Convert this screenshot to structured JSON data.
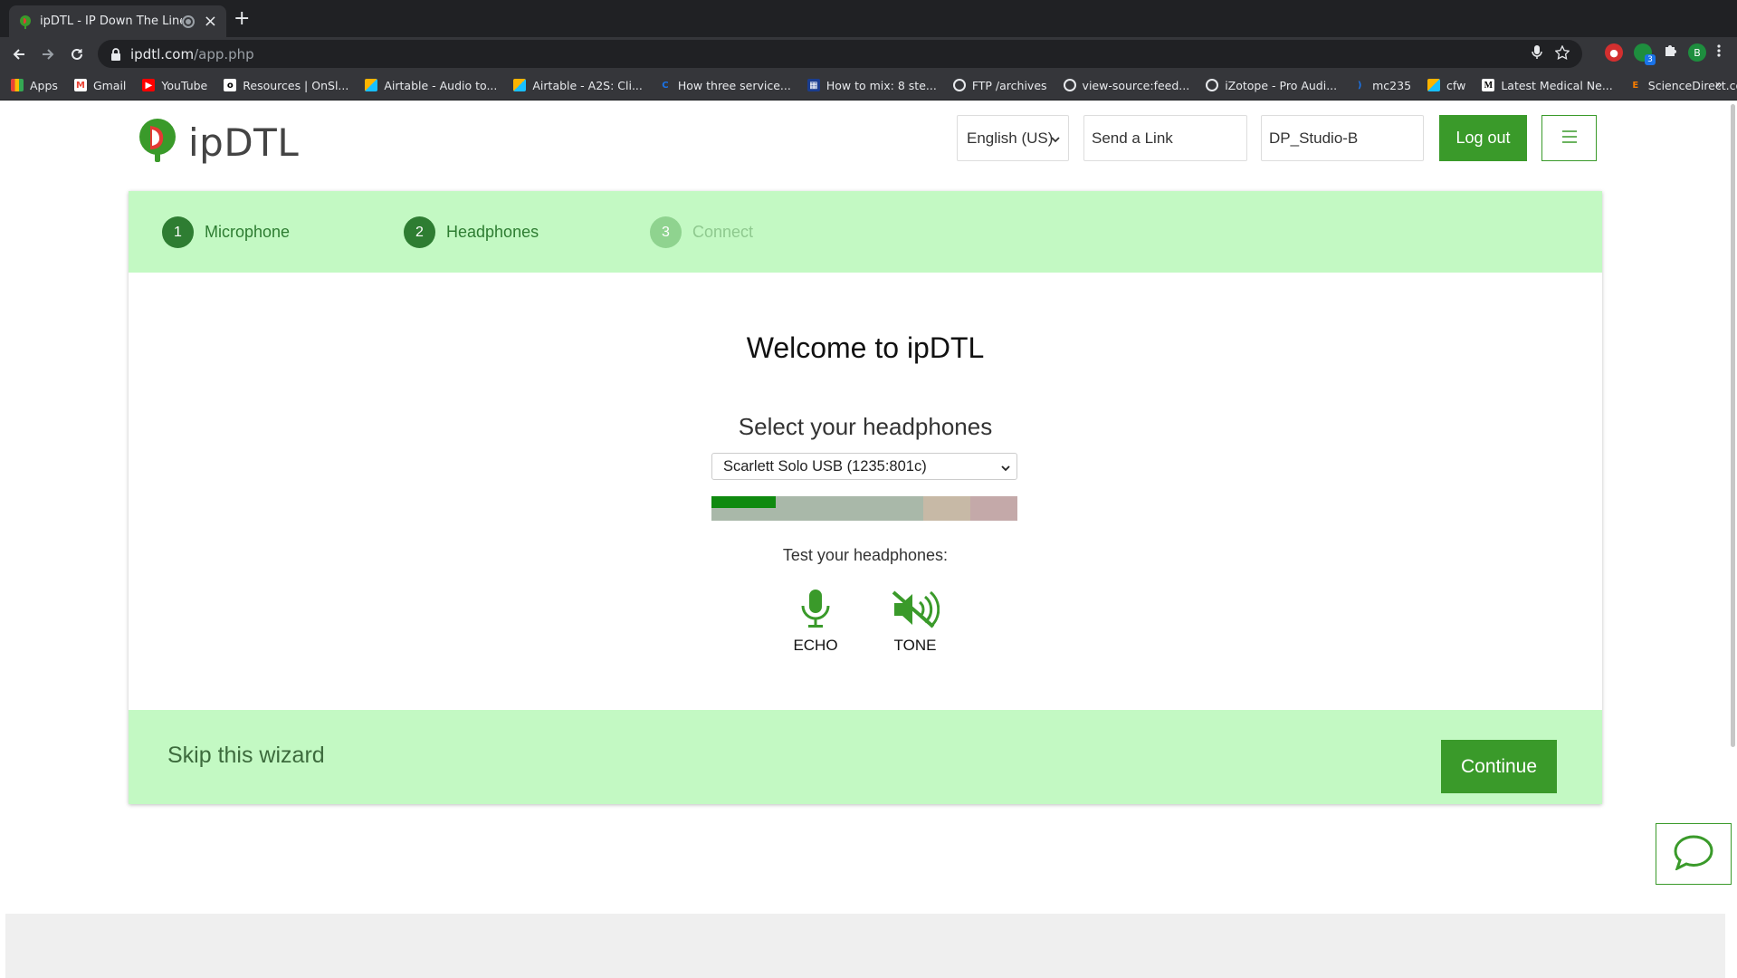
{
  "browser": {
    "tab_title": "ipDTL - IP Down The Line",
    "tab_close": "×",
    "new_tab": "+",
    "url_host": "ipdtl.com",
    "url_path": "/app.php",
    "profile_initial": "B",
    "extension_badge": "3",
    "bookmarks": [
      {
        "label": "Apps",
        "icon": "apps-grid-icon"
      },
      {
        "label": "Gmail",
        "icon": "gmail-icon"
      },
      {
        "label": "YouTube",
        "icon": "youtube-icon"
      },
      {
        "label": "Resources | OnSl...",
        "icon": "onsl-icon"
      },
      {
        "label": "Airtable - Audio to...",
        "icon": "airtable-icon"
      },
      {
        "label": "Airtable - A2S: Cli...",
        "icon": "airtable-icon"
      },
      {
        "label": "How three service...",
        "icon": "c-icon"
      },
      {
        "label": "How to mix: 8 ste...",
        "icon": "article-icon"
      },
      {
        "label": "FTP /archives",
        "icon": "globe-icon"
      },
      {
        "label": "view-source:feed...",
        "icon": "globe-icon"
      },
      {
        "label": "iZotope - Pro Audi...",
        "icon": "globe-icon"
      },
      {
        "label": "mc235",
        "icon": "mc-icon"
      },
      {
        "label": "cfw",
        "icon": "airtable-icon"
      },
      {
        "label": "Latest Medical Ne...",
        "icon": "m-icon"
      },
      {
        "label": "ScienceDirect.co...",
        "icon": "elsevier-icon"
      }
    ],
    "bookmarks_overflow": "»"
  },
  "header": {
    "logo_text": "ipDTL",
    "language": "English (US)",
    "send_link": "Send a Link",
    "station": "DP_Studio-B",
    "logout": "Log out"
  },
  "wizard": {
    "steps": [
      {
        "num": "1",
        "label": "Microphone",
        "state": "done"
      },
      {
        "num": "2",
        "label": "Headphones",
        "state": "active"
      },
      {
        "num": "3",
        "label": "Connect",
        "state": "pending"
      }
    ],
    "title": "Welcome to ipDTL",
    "subtitle": "Select your headphones",
    "device": "Scarlett Solo USB (1235:801c)",
    "level_fraction": 0.21,
    "test_label": "Test your headphones:",
    "echo_label": "ECHO",
    "tone_label": "TONE",
    "skip": "Skip this wizard",
    "continue": "Continue"
  },
  "colors": {
    "brand_green": "#3a9a2a",
    "step_bg": "#c3f9c3",
    "step_done": "#2e7d32",
    "step_pending": "#8fd38f",
    "meter_green": "#0f8a0f"
  }
}
